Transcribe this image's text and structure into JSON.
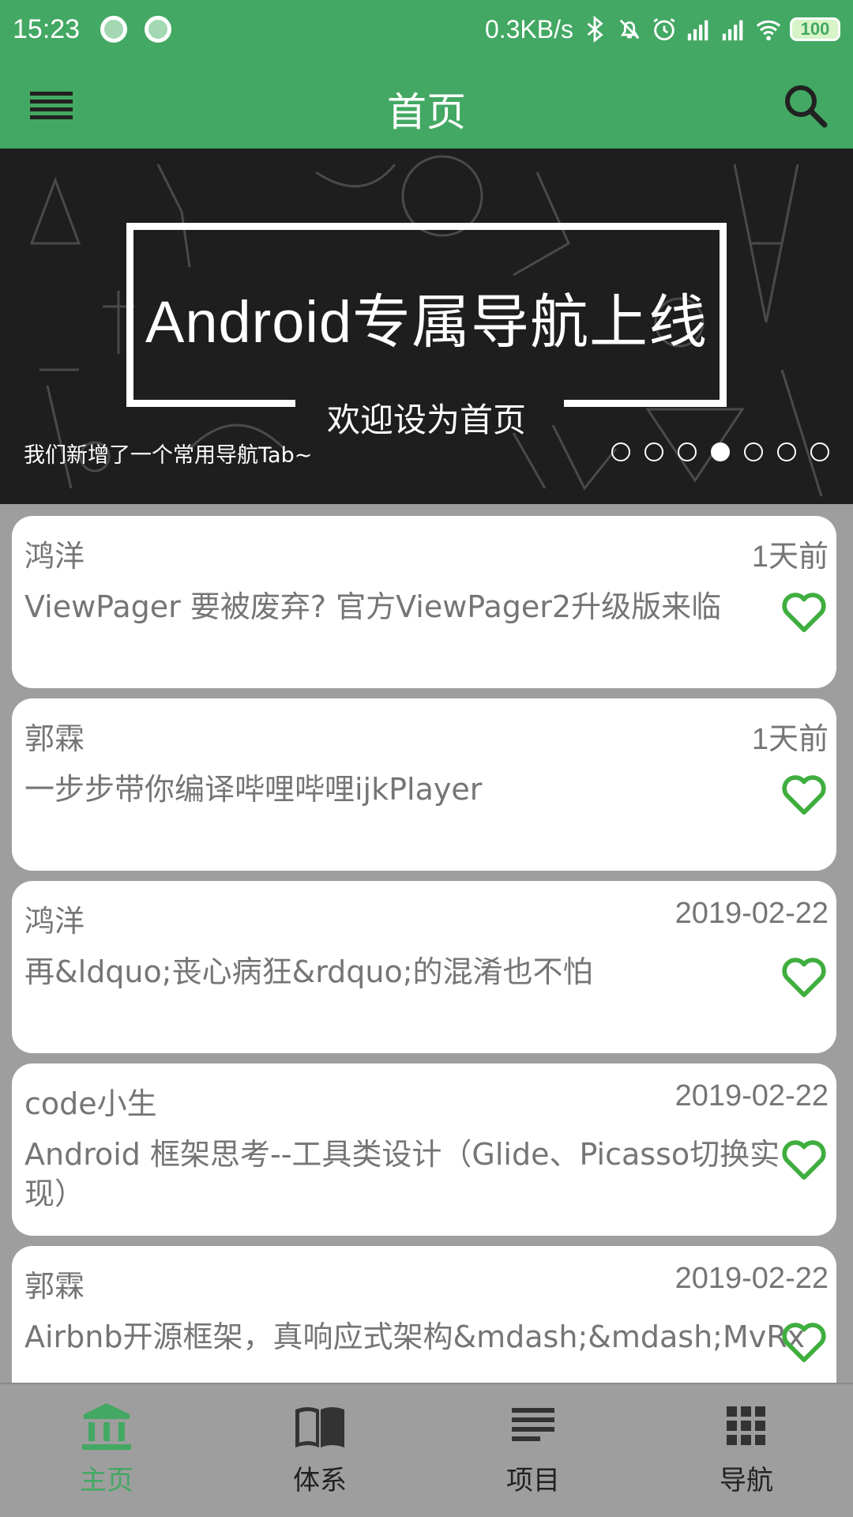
{
  "status_bar": {
    "time": "15:23",
    "network_speed": "0.3KB/s",
    "battery": "100"
  },
  "app_bar": {
    "title": "首页"
  },
  "banner": {
    "headline": "Android专属导航上线",
    "subtitle": "欢迎设为首页",
    "caption": "我们新增了一个常用导航Tab~",
    "page_count": 7,
    "active_index": 3
  },
  "articles": [
    {
      "author": "鸿洋",
      "date": "1天前",
      "title": "ViewPager 要被废弃? 官方ViewPager2升级版来临"
    },
    {
      "author": "郭霖",
      "date": "1天前",
      "title": "一步步带你编译哔哩哔哩ijkPlayer"
    },
    {
      "author": "鸿洋",
      "date": "2019-02-22",
      "title": "再&ldquo;丧心病狂&rdquo;的混淆也不怕"
    },
    {
      "author": "code小生",
      "date": "2019-02-22",
      "title": "Android 框架思考--工具类设计（Glide、Picasso切换实现）"
    },
    {
      "author": "郭霖",
      "date": "2019-02-22",
      "title": "Airbnb开源框架，真响应式架构&mdash;&mdash;MvRx"
    }
  ],
  "bottom_nav": {
    "items": [
      {
        "label": "主页",
        "icon": "bank-icon",
        "active": true
      },
      {
        "label": "体系",
        "icon": "book-icon",
        "active": false
      },
      {
        "label": "项目",
        "icon": "list-icon",
        "active": false
      },
      {
        "label": "导航",
        "icon": "grid-icon",
        "active": false
      }
    ]
  },
  "colors": {
    "primary": "#43a863",
    "favorite": "#3fae3f",
    "text_secondary": "#757575"
  }
}
